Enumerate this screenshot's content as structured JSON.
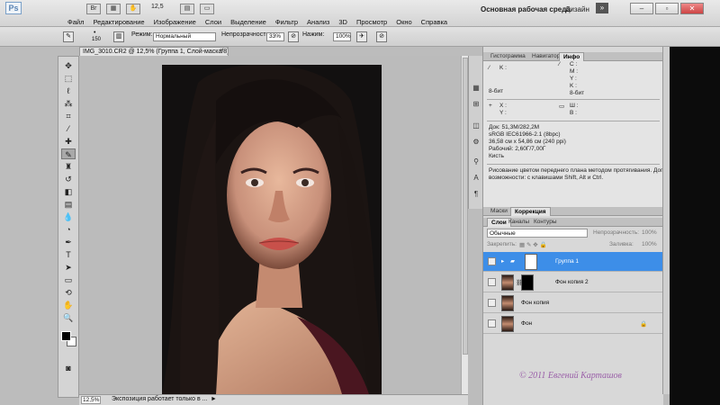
{
  "app": {
    "logo": "Ps",
    "zoom": "12,5",
    "workspace": "Основная рабочая среда",
    "design": "Дизайн",
    "menu": [
      "Файл",
      "Редактирование",
      "Изображение",
      "Слои",
      "Выделение",
      "Фильтр",
      "Анализ",
      "3D",
      "Просмотр",
      "Окно",
      "Справка"
    ]
  },
  "options": {
    "brush_size": "150",
    "mode_label": "Режим:",
    "mode_value": "Нормальный",
    "opacity_label": "Непрозрачность:",
    "opacity_value": "33%",
    "flow_label": "Нажим:",
    "flow_value": "100%"
  },
  "document": {
    "tab": "IMG_3010.CR2 @ 12,5% (Группа 1, Слой-маска/8)",
    "tab_close": "×"
  },
  "status": {
    "zoom": "12,5%",
    "text": "Экспозиция работает только в ...",
    "arrow": "►"
  },
  "info_panel": {
    "tabs": [
      "Гистограмма",
      "Навигатор",
      "Инфо"
    ],
    "active_tab": "Инфо",
    "k_label": "K :",
    "c_label": "C :",
    "m_label": "M :",
    "y_label": "Y :",
    "k2_label": "K :",
    "bits_left": "8-бит",
    "bits_right": "8-бит",
    "x_label": "X :",
    "y_coord_label": "Y :",
    "w_label": "Ш :",
    "h_label": "В :",
    "doc_line": "Док: 51,3M/282,2M",
    "color_line": "sRGB IEC61966-2.1 (8bpc)",
    "size_line": "36,58 см x 54,86 см (240 ppi)",
    "work_line": "Рабочий: 2,60Г/7,00Г",
    "tool_line": "Кисть",
    "hint_line1": "Рисование цветом переднего плана методом протягивания. Доп.",
    "hint_line2": "возможности: с клавишами Shift, Alt и Ctrl."
  },
  "layers_panel": {
    "upper_tabs": [
      "Маски",
      "Коррекция"
    ],
    "tabs": [
      "Слои",
      "Каналы",
      "Контуры"
    ],
    "blend_mode": "Обычные",
    "opacity_label": "Непрозрачность:",
    "opacity_value": "100%",
    "lock_label": "Закрепить:",
    "fill_label": "Заливка:",
    "fill_value": "100%",
    "layers": [
      {
        "name": "Группа 1",
        "selected": true
      },
      {
        "name": "Фон копия 2",
        "selected": false
      },
      {
        "name": "Фон копия",
        "selected": false
      },
      {
        "name": "Фон",
        "selected": false
      }
    ],
    "lock_icon": "🔒"
  },
  "watermark": "© 2011 Евгений Карташов",
  "colors": {
    "selection": "#3d8ee8",
    "watermark": "#9a5fa8"
  }
}
